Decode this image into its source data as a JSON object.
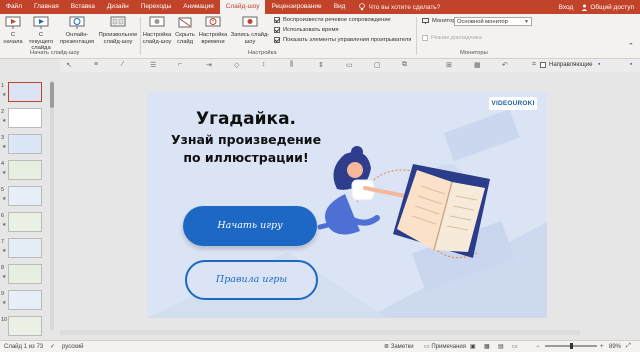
{
  "tabs": [
    "Файл",
    "Главная",
    "Вставка",
    "Дизайн",
    "Переходы",
    "Анимация",
    "Слайд-шоу",
    "Рецензирование",
    "Вид"
  ],
  "tell_me": "Что вы хотите сделать?",
  "signin": "Вход",
  "share": "Общий доступ",
  "ribbon": {
    "start_from_beginning": "С начала",
    "from_current": "С текущего слайда",
    "online": "Онлайн-презентация",
    "custom": "Произвольное слайд-шоу",
    "group_start": "Начать слайд-шоу",
    "setup": "Настройка слайд-шоу",
    "hide_slide": "Скрыть слайд",
    "rehearse": "Настройка времени",
    "record": "Запись слайд-шоу",
    "group_setup": "Настройка",
    "chk_narration": "Воспроизвести речевое сопровождение",
    "chk_timings": "Использовать время",
    "chk_controls": "Показать элементы управления проигрывателя",
    "monitor_label": "Монитор:",
    "monitor_value": "Основной монитор",
    "presenter_view": "Режим докладчика",
    "group_monitors": "Мониторы"
  },
  "guides": "Направляющие",
  "thumbnails": [
    "1",
    "2",
    "3",
    "4",
    "5",
    "6",
    "7",
    "8",
    "9",
    "10"
  ],
  "slide": {
    "title1": "Угадайка.",
    "title2": "Узнай произведение",
    "title3": "по иллюстрации!",
    "brand": "VIDEOUROKI",
    "start_button": "Начать игру",
    "rules_button": "Правила игры"
  },
  "status": {
    "slide_of": "Слайд 1 из 73",
    "language": "русский",
    "notes": "Заметки",
    "comments": "Примечания",
    "zoom": "89%"
  },
  "colors": {
    "accent": "#c1432a",
    "button_blue": "#1c68c4",
    "slide_bg": "#dbe4f4"
  }
}
